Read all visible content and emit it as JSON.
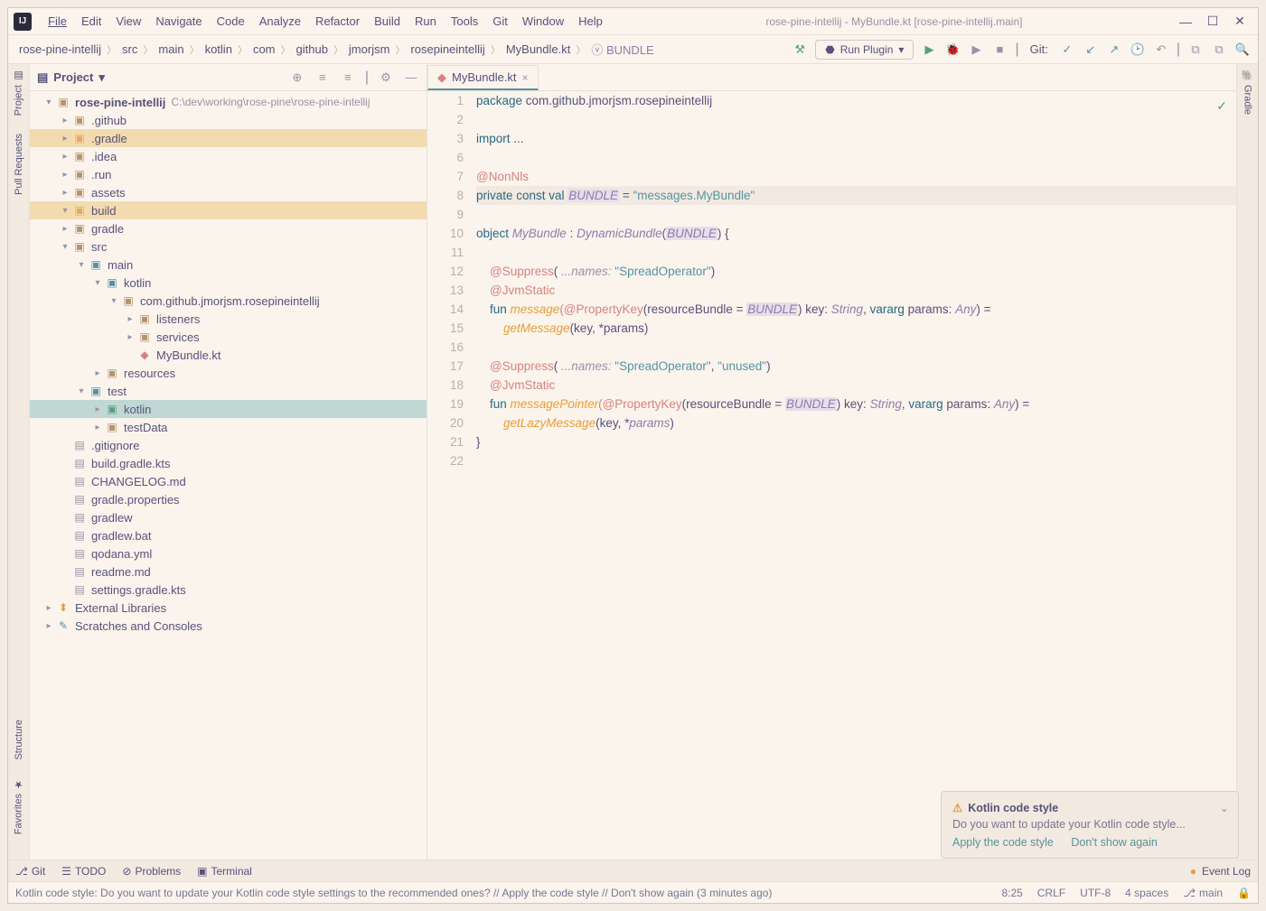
{
  "title": "rose-pine-intellij - MyBundle.kt [rose-pine-intellij.main]",
  "menu": [
    "File",
    "Edit",
    "View",
    "Navigate",
    "Code",
    "Analyze",
    "Refactor",
    "Build",
    "Run",
    "Tools",
    "Git",
    "Window",
    "Help"
  ],
  "breadcrumbs": [
    "rose-pine-intellij",
    "src",
    "main",
    "kotlin",
    "com",
    "github",
    "jmorjsm",
    "rosepineintellij",
    "MyBundle.kt",
    "BUNDLE"
  ],
  "run_config": "Run Plugin",
  "git_label": "Git:",
  "left_tabs": {
    "project": "Project",
    "pull_requests": "Pull Requests",
    "structure": "Structure",
    "favorites": "Favorites"
  },
  "right_tabs": {
    "gradle": "Gradle"
  },
  "pane": {
    "title": "Project"
  },
  "tree": {
    "root": {
      "name": "rose-pine-intellij",
      "path": "C:\\dev\\working\\rose-pine\\rose-pine-intellij"
    },
    "items": [
      {
        "indent": 1,
        "name": ".github"
      },
      {
        "indent": 1,
        "name": ".gradle",
        "hl": "gold"
      },
      {
        "indent": 1,
        "name": ".idea"
      },
      {
        "indent": 1,
        "name": ".run"
      },
      {
        "indent": 1,
        "name": "assets"
      },
      {
        "indent": 1,
        "name": "build",
        "hl": "gold",
        "expand": "▾"
      },
      {
        "indent": 1,
        "name": "gradle"
      },
      {
        "indent": 1,
        "name": "src",
        "expand": "▾"
      },
      {
        "indent": 2,
        "name": "main",
        "expand": "▾",
        "blue": true
      },
      {
        "indent": 3,
        "name": "kotlin",
        "expand": "▾",
        "blue": true
      },
      {
        "indent": 4,
        "name": "com.github.jmorjsm.rosepineintellij",
        "expand": "▾"
      },
      {
        "indent": 5,
        "name": "listeners",
        "expand": "▸"
      },
      {
        "indent": 5,
        "name": "services",
        "expand": "▸"
      },
      {
        "indent": 5,
        "name": "MyBundle.kt",
        "file": "kt"
      },
      {
        "indent": 3,
        "name": "resources",
        "expand": "▸"
      },
      {
        "indent": 2,
        "name": "test",
        "expand": "▾",
        "blue": true
      },
      {
        "indent": 3,
        "name": "kotlin",
        "expand": "▸",
        "hl": "teal",
        "green": true
      },
      {
        "indent": 3,
        "name": "testData",
        "expand": "▸"
      },
      {
        "indent": 1,
        "name": ".gitignore",
        "file": "f"
      },
      {
        "indent": 1,
        "name": "build.gradle.kts",
        "file": "f"
      },
      {
        "indent": 1,
        "name": "CHANGELOG.md",
        "file": "f"
      },
      {
        "indent": 1,
        "name": "gradle.properties",
        "file": "f"
      },
      {
        "indent": 1,
        "name": "gradlew",
        "file": "f"
      },
      {
        "indent": 1,
        "name": "gradlew.bat",
        "file": "f"
      },
      {
        "indent": 1,
        "name": "qodana.yml",
        "file": "f"
      },
      {
        "indent": 1,
        "name": "readme.md",
        "file": "f"
      },
      {
        "indent": 1,
        "name": "settings.gradle.kts",
        "file": "f"
      }
    ],
    "ext_lib": "External Libraries",
    "scratches": "Scratches and Consoles"
  },
  "tab": {
    "name": "MyBundle.kt"
  },
  "code": {
    "line_numbers": [
      1,
      2,
      3,
      6,
      7,
      8,
      9,
      10,
      11,
      12,
      13,
      14,
      15,
      16,
      17,
      18,
      19,
      20,
      21,
      22
    ],
    "l1_a": "package",
    "l1_b": " com.github.jmorjsm.rosepineintellij",
    "l3_a": "import",
    "l3_b": " ...",
    "l7": "@NonNls",
    "l8_a": "private const val ",
    "l8_b": "BUNDLE",
    "l8_c": " = ",
    "l8_d": "\"messages.MyBundle\"",
    "l10_a": "object ",
    "l10_b": "MyBundle",
    "l10_c": " : ",
    "l10_d": "DynamicBundle",
    "l10_e": "(",
    "l10_f": "BUNDLE",
    "l10_g": ") {",
    "l12_a": "    @Suppress",
    "l12_b": "( ",
    "l12_c": "...names:",
    "l12_d": " \"SpreadOperator\"",
    "l12_e": ")",
    "l13": "    @JvmStatic",
    "l14_a": "    fun ",
    "l14_b": "message",
    "l14_c": "(@PropertyKey",
    "l14_d": "(resourceBundle = ",
    "l14_e": "BUNDLE",
    "l14_f": ") key: ",
    "l14_g": "String",
    "l14_h": ", ",
    "l14_i": "vararg",
    "l14_j": " params: ",
    "l14_k": "Any",
    "l14_l": ") =",
    "l15_a": "        ",
    "l15_b": "getMessage",
    "l15_c": "(key, *params)",
    "l17_a": "    @Suppress",
    "l17_b": "( ",
    "l17_c": "...names:",
    "l17_d": " \"SpreadOperator\"",
    "l17_e": ", ",
    "l17_f": "\"unused\"",
    "l17_g": ")",
    "l18": "    @JvmStatic",
    "l19_a": "    fun ",
    "l19_b": "messagePointer",
    "l19_c": "(@PropertyKey",
    "l19_d": "(resourceBundle = ",
    "l19_e": "BUNDLE",
    "l19_f": ") key: ",
    "l19_g": "String",
    "l19_h": ", ",
    "l19_i": "vararg",
    "l19_j": " params: ",
    "l19_k": "Any",
    "l19_l": ") =",
    "l20_a": "        ",
    "l20_b": "getLazyMessage",
    "l20_c": "(key, *",
    "l20_d": "params",
    "l20_e": ")",
    "l21": "}"
  },
  "notif": {
    "title": "Kotlin code style",
    "body": "Do you want to update your Kotlin code style...",
    "apply": "Apply the code style",
    "dont": "Don't show again"
  },
  "bottom_tools": {
    "git": "Git",
    "todo": "TODO",
    "problems": "Problems",
    "terminal": "Terminal",
    "event_log": "Event Log"
  },
  "status": {
    "msg": "Kotlin code style: Do you want to update your Kotlin code style settings to the recommended ones? // Apply the code style // Don't show again (3 minutes ago)",
    "pos": "8:25",
    "eol": "CRLF",
    "enc": "UTF-8",
    "indent": "4 spaces",
    "branch": "main"
  }
}
